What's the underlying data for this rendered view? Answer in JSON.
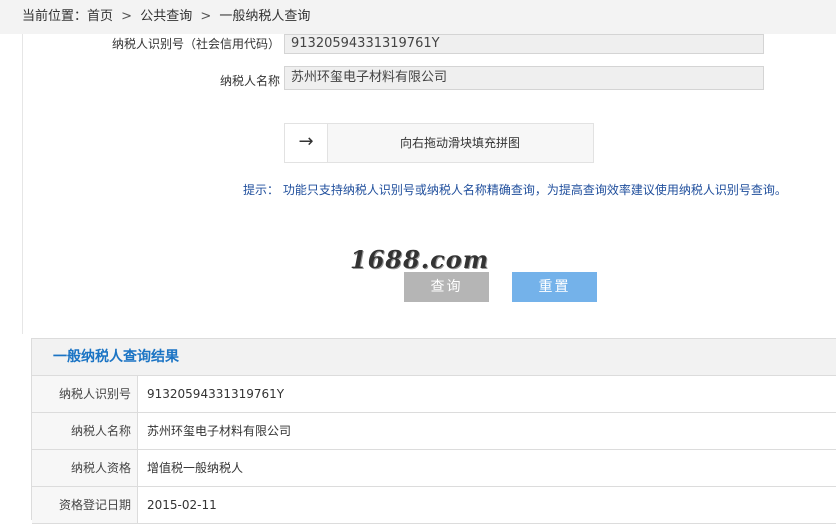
{
  "breadcrumb": {
    "prefix": "当前位置：",
    "home": "首页",
    "separator": ">",
    "level1": "公共查询",
    "level2": "一般纳税人查询"
  },
  "form": {
    "id_label": "纳税人识别号（社会信用代码）",
    "id_value": "91320594331319761Y",
    "name_label": "纳税人名称",
    "name_value": "苏州环玺电子材料有限公司",
    "slider_text": "向右拖动滑块填充拼图",
    "slider_arrow": "→",
    "hint": "提示：  功能只支持纳税人识别号或纳税人名称精确查询，为提高查询效率建议使用纳税人识别号查询。"
  },
  "watermark": "1688.com",
  "buttons": {
    "query": "查询",
    "reset": "重置"
  },
  "results": {
    "title": "一般纳税人查询结果",
    "rows": [
      {
        "label": "纳税人识别号",
        "value": "91320594331319761Y"
      },
      {
        "label": "纳税人名称",
        "value": "苏州环玺电子材料有限公司"
      },
      {
        "label": "纳税人资格",
        "value": "增值税一般纳税人"
      },
      {
        "label": "资格登记日期",
        "value": "2015-02-11"
      }
    ]
  },
  "colors": {
    "link_blue": "#1b74c4",
    "reset_button": "#74b2ea",
    "query_button": "#b5b5b5",
    "hint_text": "#1f4e9c"
  },
  "icons": {
    "slider_handle": "arrow-right-icon"
  }
}
